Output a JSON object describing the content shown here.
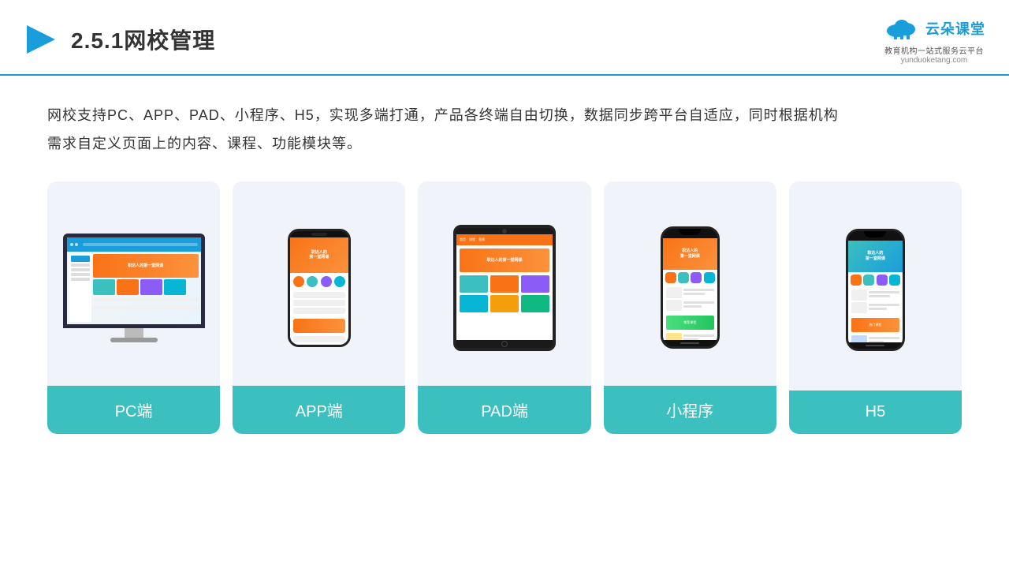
{
  "header": {
    "title": "2.5.1网校管理",
    "logo_name": "云朵课堂",
    "logo_url": "yunduoketang.com",
    "logo_tagline": "教育机构一站\n式服务云平台"
  },
  "description": "网校支持PC、APP、PAD、小程序、H5，实现多端打通，产品各终端自由切换，数据同步跨平台自适应，同时根据机构\n需求自定义页面上的内容、课程、功能模块等。",
  "cards": [
    {
      "id": "pc",
      "label": "PC端"
    },
    {
      "id": "app",
      "label": "APP端"
    },
    {
      "id": "pad",
      "label": "PAD端"
    },
    {
      "id": "miniprogram",
      "label": "小程序"
    },
    {
      "id": "h5",
      "label": "H5"
    }
  ],
  "colors": {
    "teal": "#3bbfbf",
    "accent_blue": "#1a9edb",
    "orange": "#f97316",
    "card_bg": "#eef2fa"
  }
}
